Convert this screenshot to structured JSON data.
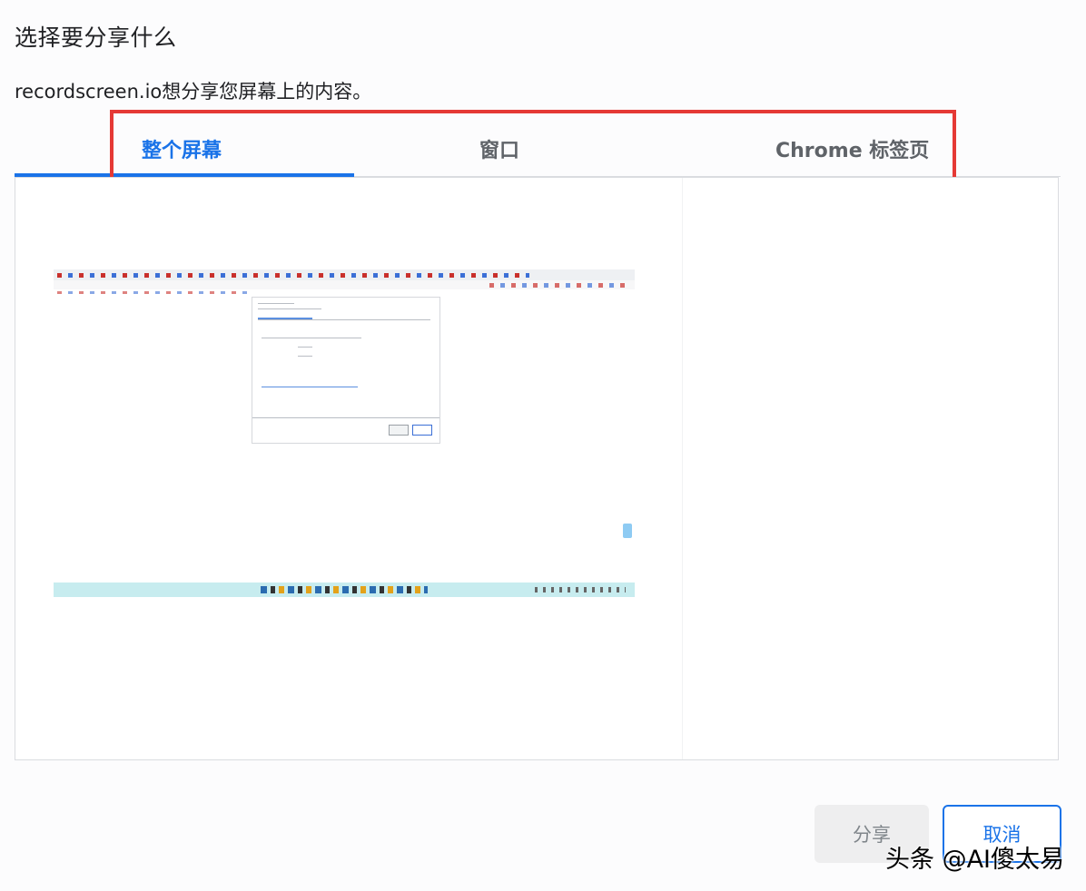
{
  "dialog": {
    "title": "选择要分享什么",
    "subtitle": "recordscreen.io想分享您屏幕上的内容。"
  },
  "tabs": [
    {
      "label": "整个屏幕",
      "active": true
    },
    {
      "label": "窗口",
      "active": false
    },
    {
      "label": "Chrome 标签页",
      "active": false
    }
  ],
  "buttons": {
    "share": "分享",
    "cancel": "取消"
  },
  "watermark": "头条 @AI傻太易",
  "colors": {
    "accent": "#1a73e8",
    "highlight": "#e53935"
  }
}
